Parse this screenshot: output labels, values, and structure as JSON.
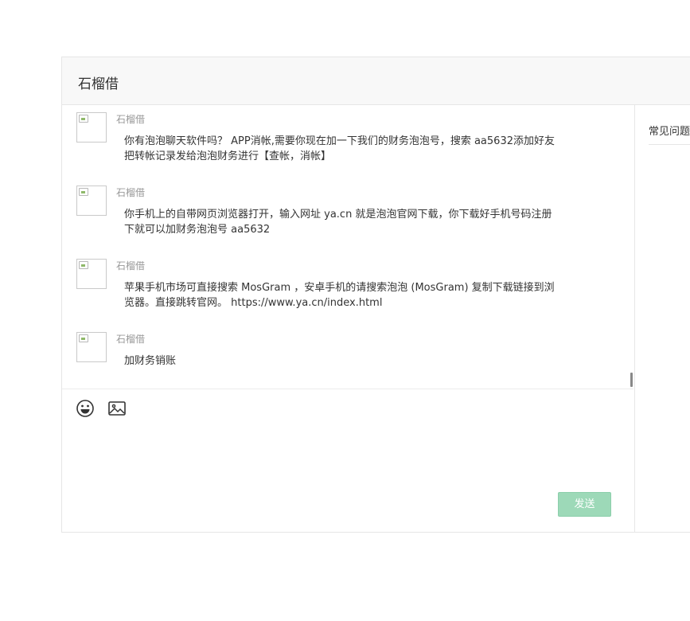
{
  "chat": {
    "title": "石榴借",
    "messages": [
      {
        "sender": "石榴借",
        "text": "你有泡泡聊天软件吗？ APP消帐,需要你现在加一下我们的财务泡泡号，搜索 aa5632添加好友把转帐记录发给泡泡财务进行【查帐，消帐】"
      },
      {
        "sender": "石榴借",
        "text": "你手机上的自带网页浏览器打开，输入网址 ya.cn 就是泡泡官网下载，你下载好手机号码注册下就可以加财务泡泡号 aa5632"
      },
      {
        "sender": "石榴借",
        "text": "苹果手机市场可直接搜索 MosGram ，安卓手机的请搜索泡泡 (MosGram) 复制下载链接到浏览器。直接跳转官网。 https://www.ya.cn/index.html"
      },
      {
        "sender": "石榴借",
        "text": "加财务销账"
      }
    ]
  },
  "sidebar": {
    "faq_title": "常见问题"
  },
  "toolbar": {
    "emoji_icon": "emoji-icon",
    "image_icon": "image-icon"
  },
  "composer": {
    "value": "",
    "placeholder": ""
  },
  "send_button": {
    "label": "发送",
    "color": "#9dd9b8"
  }
}
